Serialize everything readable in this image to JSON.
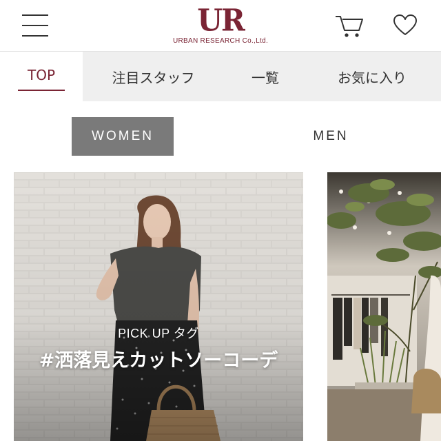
{
  "header": {
    "logo_mark": "UR",
    "logo_text": "URBAN RESEARCH Co.,Ltd.",
    "menu_icon": "hamburger-menu-icon",
    "cart_icon": "shopping-cart-icon",
    "favorite_icon": "heart-icon"
  },
  "tabs": [
    {
      "label": "TOP",
      "active": true
    },
    {
      "label": "注目スタッフ",
      "active": false
    },
    {
      "label": "一覧",
      "active": false
    },
    {
      "label": "お気に入り",
      "active": false
    }
  ],
  "gender": {
    "women_label": "WOMEN",
    "men_label": "MEN",
    "selected": "WOMEN"
  },
  "cards": [
    {
      "kicker": "PICK UP タグ",
      "title": "#洒落見えカットソーコーデ"
    },
    {
      "kicker": "",
      "title": ""
    }
  ],
  "colors": {
    "brand": "#7a2434",
    "tab_bar": "#efefef",
    "women_active": "#7a7a7a"
  }
}
